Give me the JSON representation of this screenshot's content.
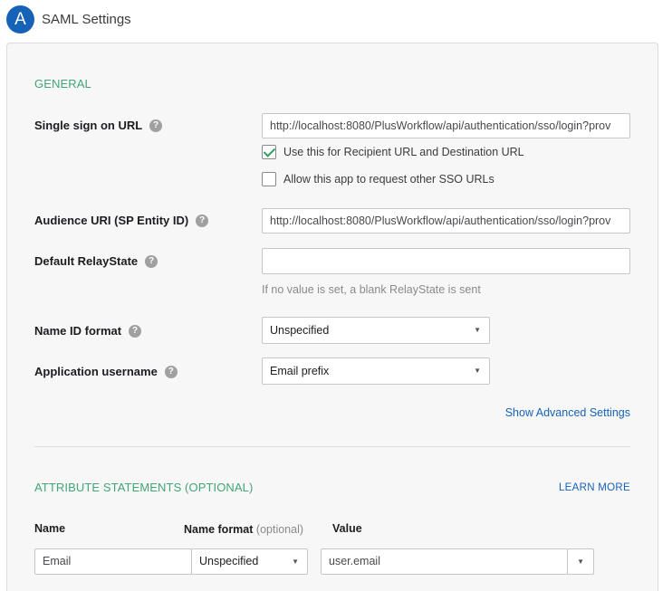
{
  "header": {
    "avatar_letter": "A",
    "title": "SAML Settings"
  },
  "general": {
    "section_title": "GENERAL",
    "sso_url": {
      "label": "Single sign on URL",
      "value": "http://localhost:8080/PlusWorkflow/api/authentication/sso/login?prov",
      "recipient_checkbox": {
        "label": "Use this for Recipient URL and Destination URL",
        "checked": true
      },
      "request_other_checkbox": {
        "label": "Allow this app to request other SSO URLs",
        "checked": false
      }
    },
    "audience_uri": {
      "label": "Audience URI (SP Entity ID)",
      "value": "http://localhost:8080/PlusWorkflow/api/authentication/sso/login?prov"
    },
    "relay_state": {
      "label": "Default RelayState",
      "value": "",
      "hint": "If no value is set, a blank RelayState is sent"
    },
    "name_id_format": {
      "label": "Name ID format",
      "value": "Unspecified"
    },
    "app_username": {
      "label": "Application username",
      "value": "Email prefix"
    },
    "advanced_link": "Show Advanced Settings"
  },
  "attributes": {
    "section_title": "ATTRIBUTE STATEMENTS (OPTIONAL)",
    "learn_more": "LEARN MORE",
    "columns": {
      "name": "Name",
      "name_format": "Name format",
      "name_format_note": "(optional)",
      "value": "Value"
    },
    "rows": [
      {
        "name": "Email",
        "format": "Unspecified",
        "value": "user.email"
      }
    ]
  },
  "icons": {
    "help": "help-icon",
    "dropdown": "chevron-down-icon",
    "check": "checkmark-icon"
  }
}
